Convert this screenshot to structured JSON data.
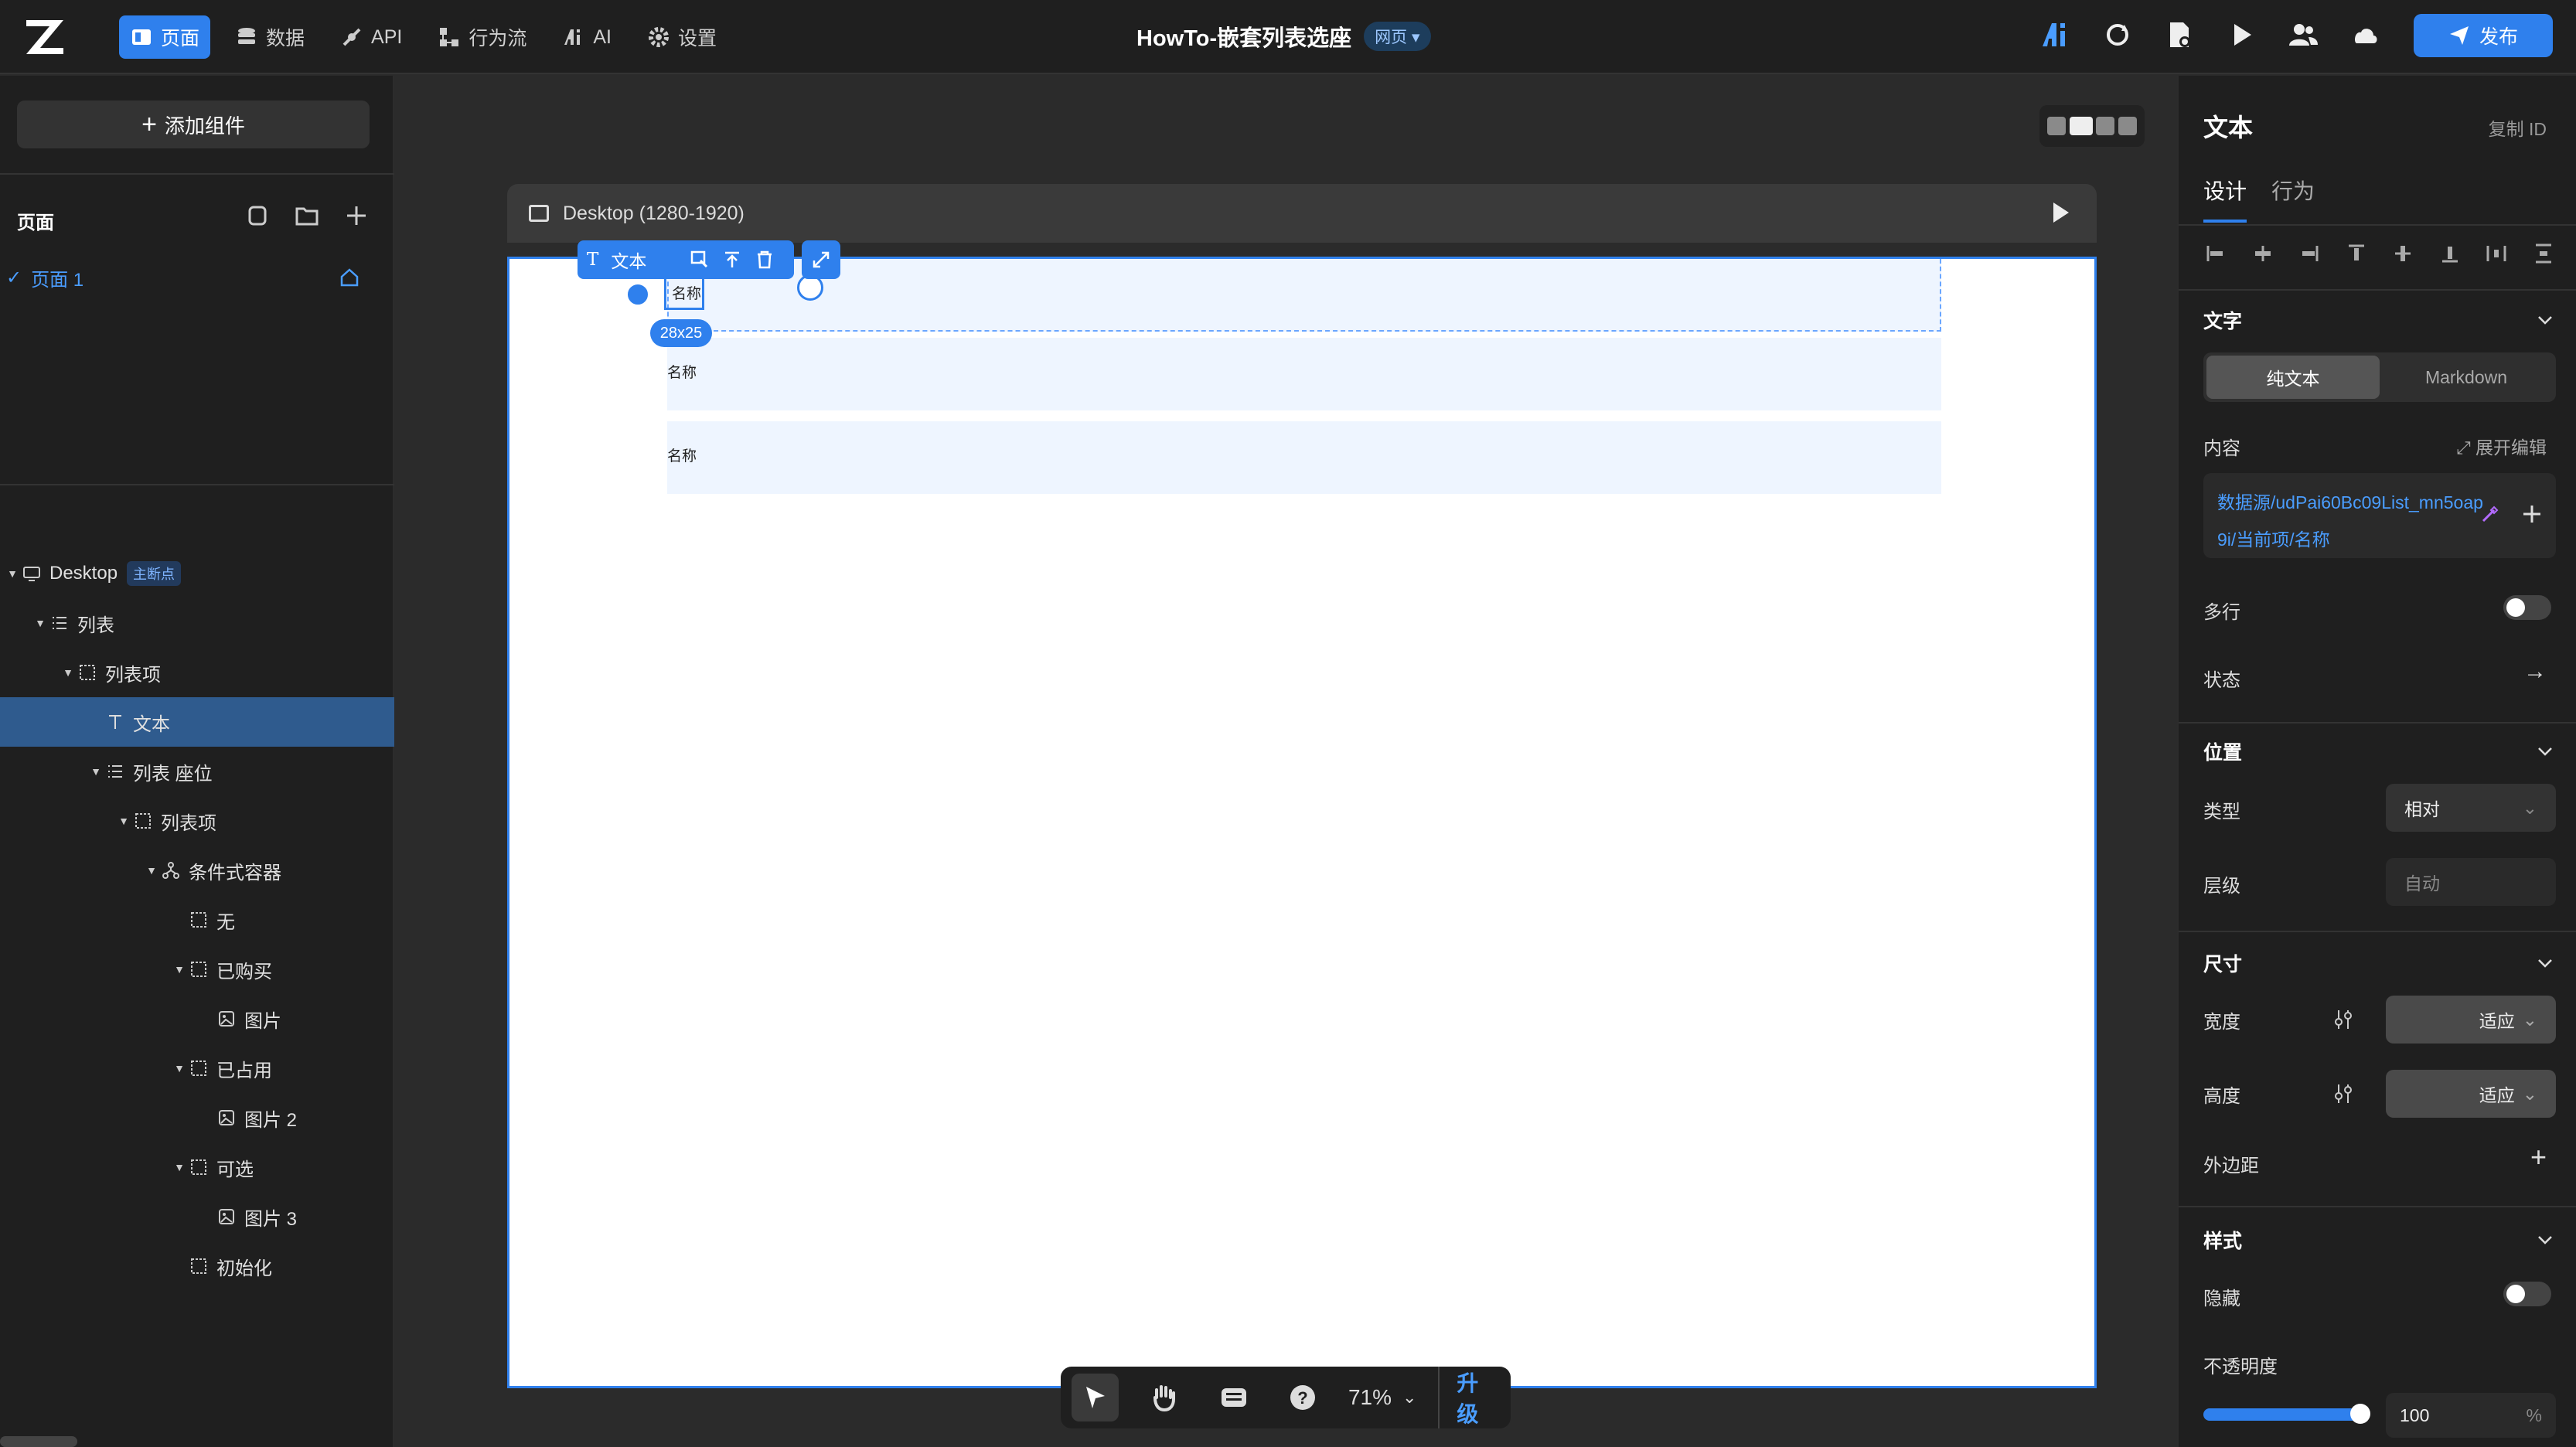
{
  "app": {
    "doc_title": "HowTo-嵌套列表选座",
    "doc_type": "网页",
    "publish_label": "发布",
    "accent": "#2f80ed"
  },
  "nav": [
    {
      "label": "页面",
      "icon": "pages-icon",
      "active": true
    },
    {
      "label": "数据",
      "icon": "database-icon"
    },
    {
      "label": "API",
      "icon": "api-icon"
    },
    {
      "label": "行为流",
      "icon": "flow-icon"
    },
    {
      "label": "AI",
      "icon": "ai-icon"
    },
    {
      "label": "设置",
      "icon": "gear-icon"
    }
  ],
  "left": {
    "add_component": "添加组件",
    "pages_title": "页面",
    "page_name": "页面 1",
    "tree": [
      {
        "label": "Desktop",
        "badge": "主断点",
        "icon": "monitor-icon",
        "depth": 0,
        "expanded": true
      },
      {
        "label": "列表",
        "icon": "list-icon",
        "depth": 1,
        "expanded": true
      },
      {
        "label": "列表项",
        "icon": "box-icon",
        "depth": 2,
        "expanded": true
      },
      {
        "label": "文本",
        "icon": "text-icon",
        "depth": 3,
        "selected": true
      },
      {
        "label": "列表 座位",
        "icon": "list-icon",
        "depth": 3,
        "expanded": true
      },
      {
        "label": "列表项",
        "icon": "box-icon",
        "depth": 4,
        "expanded": true
      },
      {
        "label": "条件式容器",
        "icon": "condition-icon",
        "depth": 5,
        "expanded": true
      },
      {
        "label": "无",
        "icon": "box-icon",
        "depth": 6
      },
      {
        "label": "已购买",
        "icon": "box-icon",
        "depth": 6,
        "expanded": true
      },
      {
        "label": "图片",
        "icon": "image-icon",
        "depth": 7
      },
      {
        "label": "已占用",
        "icon": "box-icon",
        "depth": 6,
        "expanded": true
      },
      {
        "label": "图片 2",
        "icon": "image-icon",
        "depth": 7
      },
      {
        "label": "可选",
        "icon": "box-icon",
        "depth": 6,
        "expanded": true
      },
      {
        "label": "图片 3",
        "icon": "image-icon",
        "depth": 7
      },
      {
        "label": "初始化",
        "icon": "box-icon",
        "depth": 6
      }
    ]
  },
  "canvas": {
    "frame_label": "Desktop (1280-1920)",
    "items": [
      "名称",
      "名称",
      "名称"
    ],
    "selected_text": "名称",
    "size_tag": "28x25",
    "float_toolbar_label": "文本",
    "zoom": "71%",
    "upgrade": "升级"
  },
  "right": {
    "title": "文本",
    "copy_id": "复制 ID",
    "tabs": [
      "设计",
      "行为"
    ],
    "text_section": "文字",
    "mode_plain": "纯文本",
    "mode_md": "Markdown",
    "content_label": "内容",
    "expand_edit": "展开编辑",
    "content_value": "数据源/udPai60Bc09List_mn5oap9i/当前项/名称",
    "multiline": "多行",
    "state": "状态",
    "position_section": "位置",
    "type_label": "类型",
    "type_value": "相对",
    "layer_label": "层级",
    "layer_placeholder": "自动",
    "size_section": "尺寸",
    "width_label": "宽度",
    "width_value": "适应",
    "height_label": "高度",
    "height_value": "适应",
    "margin_label": "外边距",
    "style_section": "样式",
    "hidden_label": "隐藏",
    "opacity_label": "不透明度",
    "opacity_value": "100",
    "opacity_unit": "%"
  }
}
